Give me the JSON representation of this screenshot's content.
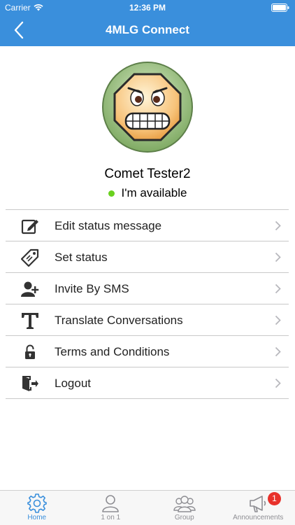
{
  "status_bar": {
    "carrier": "Carrier",
    "time": "12:36 PM"
  },
  "nav": {
    "title": "4MLG Connect",
    "back_icon": "chevron-left-icon"
  },
  "profile": {
    "name": "Comet Tester2",
    "status": "I'm available",
    "status_color": "#6ad11f",
    "avatar_icon": "grimacing-face-icon"
  },
  "menu": {
    "items": [
      {
        "label": "Edit status message",
        "icon": "edit-icon"
      },
      {
        "label": "Set status",
        "icon": "tag-icon"
      },
      {
        "label": "Invite By SMS",
        "icon": "add-user-icon"
      },
      {
        "label": "Translate Conversations",
        "icon": "text-t-icon"
      },
      {
        "label": "Terms and Conditions",
        "icon": "lock-icon"
      },
      {
        "label": "Logout",
        "icon": "logout-icon"
      }
    ]
  },
  "tabs": [
    {
      "label": "Home",
      "icon": "gear-icon",
      "active": true
    },
    {
      "label": "1 on 1",
      "icon": "user-icon"
    },
    {
      "label": "Group",
      "icon": "group-icon"
    },
    {
      "label": "Announcements",
      "icon": "megaphone-icon",
      "badge": "1"
    }
  ],
  "colors": {
    "accent": "#3a8fdc",
    "badge": "#e8312b"
  }
}
